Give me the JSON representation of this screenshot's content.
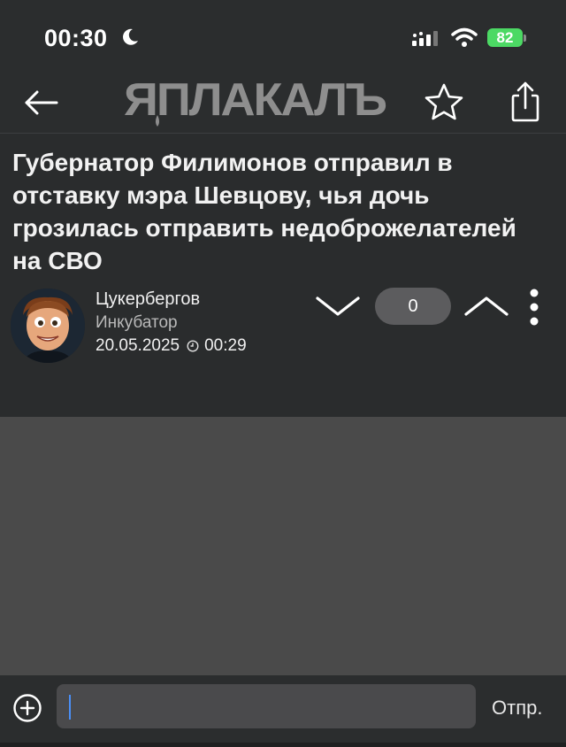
{
  "status_bar": {
    "time": "00:30",
    "battery": "82"
  },
  "nav": {
    "logo_text": "ЯПЛАКАЛЪ"
  },
  "post": {
    "title": "Губернатор Филимонов отправил в отставку мэра Шевцову, чья дочь грозилась отправить недоброжелателей на СВО",
    "author": "Цукербергов",
    "rank": "Инкубатор",
    "date": "20.05.2025",
    "time": "00:29",
    "rating": "0"
  },
  "compose": {
    "placeholder": "",
    "send_label": "Отпр."
  },
  "colors": {
    "background": "#2a2c2d",
    "content_area": "#4a4a4a",
    "vote_pill": "#5c5c5e",
    "battery": "#4cd964",
    "caret": "#4a8ff7"
  }
}
